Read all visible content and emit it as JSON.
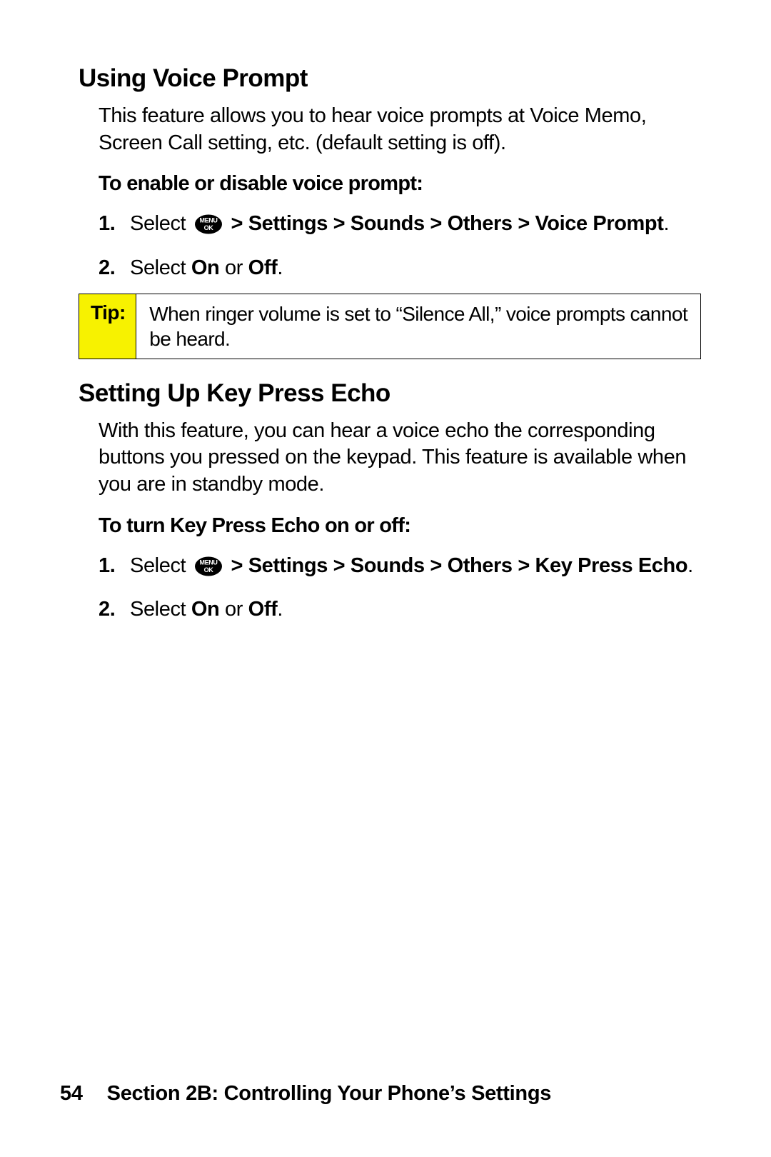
{
  "section1": {
    "heading": "Using Voice Prompt",
    "intro": "This feature allows you to hear voice prompts at Voice Memo, Screen Call setting, etc. (default setting is off).",
    "subheading": "To enable or disable voice prompt:",
    "step1_prefix": "Select ",
    "step1_menu": "MENU",
    "step1_ok": "OK",
    "step1_gt1": " > ",
    "step1_b_settings": "Settings",
    "step1_gt2": " > ",
    "step1_b_sounds": "Sounds",
    "step1_gt3": " > ",
    "step1_b_others": "Others",
    "step1_gt4": " > ",
    "step1_b_voiceprompt": "Voice Prompt",
    "step1_period": ".",
    "step2_prefix": "Select ",
    "step2_on": "On",
    "step2_or": " or ",
    "step2_off": "Off",
    "step2_period": "."
  },
  "tip": {
    "label": "Tip:",
    "content": "When ringer volume is set to “Silence All,” voice prompts cannot be heard."
  },
  "section2": {
    "heading": "Setting Up Key Press Echo",
    "intro": "With this feature, you can hear a voice echo the corresponding buttons you pressed on the keypad. This feature is available when you are in standby mode.",
    "subheading": "To turn Key Press Echo on or off:",
    "step1_prefix": "Select ",
    "step1_menu": "MENU",
    "step1_ok": "OK",
    "step1_gt1": " > ",
    "step1_b_settings": "Settings",
    "step1_gt2": " > ",
    "step1_b_sounds": "Sounds",
    "step1_gt3": " > ",
    "step1_b_others": "Others",
    "step1_gt4": " > ",
    "step1_b_keypressecho": "Key Press Echo",
    "step1_period": ".",
    "step2_prefix": "Select ",
    "step2_on": "On",
    "step2_or": " or ",
    "step2_off": "Off",
    "step2_period": "."
  },
  "footer": {
    "page": "54",
    "section_label": "Section 2B: Controlling Your Phone’s Settings"
  }
}
